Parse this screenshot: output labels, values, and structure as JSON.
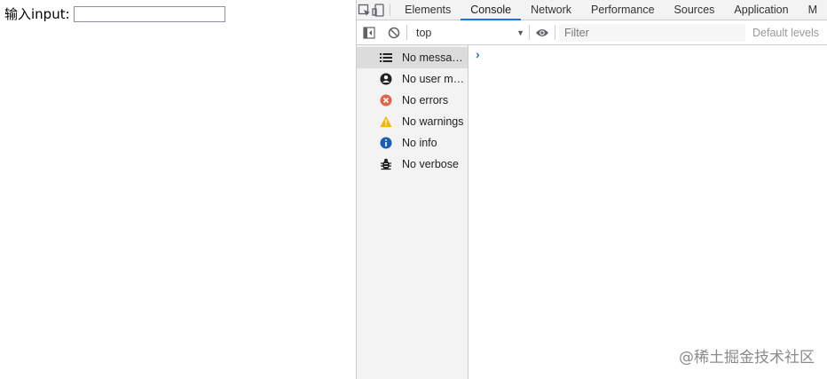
{
  "page": {
    "label": "输入input:",
    "input_value": ""
  },
  "devtools": {
    "tabs": [
      {
        "label": "Elements"
      },
      {
        "label": "Console"
      },
      {
        "label": "Network"
      },
      {
        "label": "Performance"
      },
      {
        "label": "Sources"
      },
      {
        "label": "Application"
      },
      {
        "label": "M"
      }
    ],
    "active_tab": "Console",
    "toolbar": {
      "context": "top",
      "filter_placeholder": "Filter",
      "levels": "Default levels"
    },
    "sidebar": {
      "items": [
        {
          "label": "No messages",
          "icon": "list-icon"
        },
        {
          "label": "No user me...",
          "icon": "user-icon"
        },
        {
          "label": "No errors",
          "icon": "error-icon"
        },
        {
          "label": "No warnings",
          "icon": "warning-icon"
        },
        {
          "label": "No info",
          "icon": "info-icon"
        },
        {
          "label": "No verbose",
          "icon": "bug-icon"
        }
      ]
    },
    "prompt": "›"
  },
  "watermark": "@稀土掘金技术社区",
  "colors": {
    "accent": "#1a73e8",
    "error": "#e0634a",
    "warning": "#f4b400",
    "info": "#1a5fb4"
  }
}
